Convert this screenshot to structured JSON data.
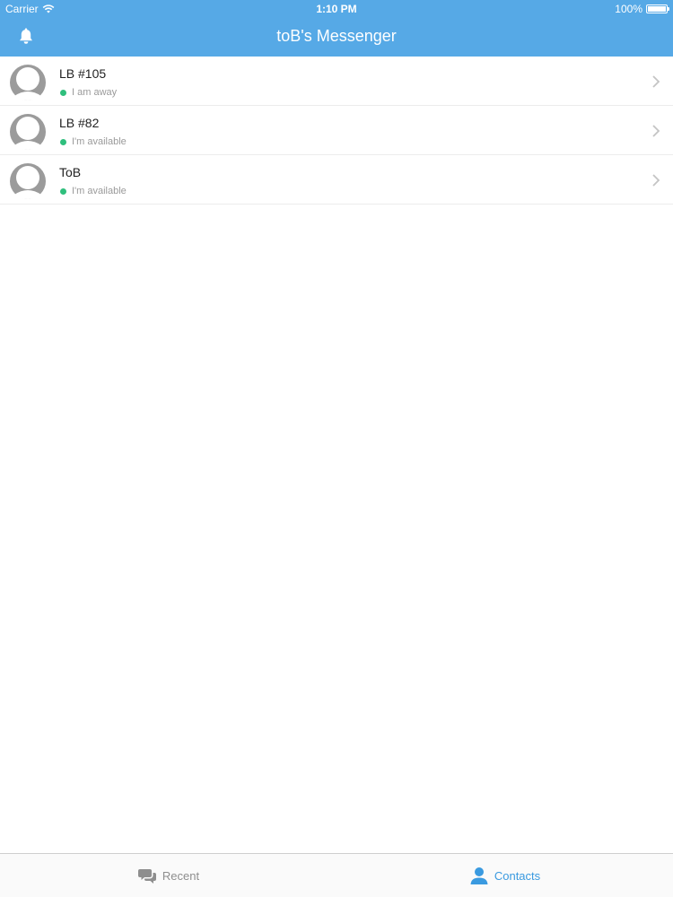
{
  "status_bar": {
    "carrier": "Carrier",
    "time": "1:10 PM",
    "battery": "100%"
  },
  "nav": {
    "title": "toB's Messenger",
    "left_icon": "bell-icon"
  },
  "contacts": [
    {
      "name": "LB #105",
      "status": "I am away",
      "status_color": "#2fbf7d"
    },
    {
      "name": "LB #82",
      "status": "I'm available",
      "status_color": "#2fbf7d"
    },
    {
      "name": "ToB",
      "status": "I'm available",
      "status_color": "#2fbf7d"
    }
  ],
  "tabs": [
    {
      "label": "Recent",
      "icon": "chat-bubbles-icon",
      "active": false
    },
    {
      "label": "Contacts",
      "icon": "person-icon",
      "active": true
    }
  ],
  "colors": {
    "accent": "#56a9e6",
    "active_tab": "#3a9ae0",
    "inactive_tab": "#8e8e8e",
    "online": "#2fbf7d"
  }
}
